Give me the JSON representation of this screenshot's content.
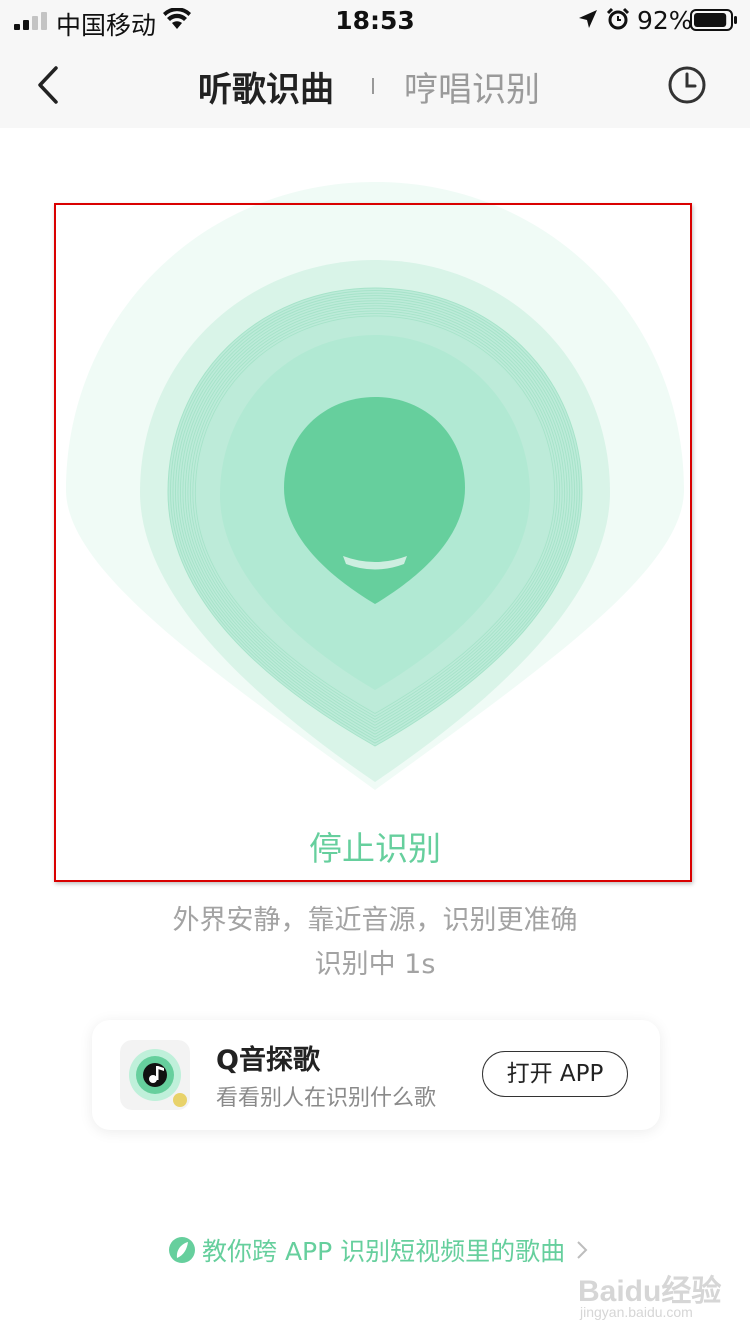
{
  "status_bar": {
    "carrier": "中国移动",
    "time": "18:53",
    "battery_percent": "92%",
    "battery_level": 0.92,
    "icons": [
      "signal-icon",
      "wifi-icon",
      "location-arrow-icon",
      "alarm-icon",
      "battery-icon"
    ]
  },
  "nav": {
    "tabs": [
      {
        "label": "听歌识曲",
        "active": true
      },
      {
        "label": "哼唱识别",
        "active": false
      }
    ],
    "icons": [
      "back-icon",
      "history-icon"
    ]
  },
  "recognition": {
    "stop_label": "停止识别",
    "hint": "外界安静，靠近音源，识别更准确",
    "status": "识别中 1s",
    "accent_color": "#66cf9d"
  },
  "promo": {
    "title": "Q音探歌",
    "subtitle": "看看别人在识别什么歌",
    "button_label": "打开 APP"
  },
  "tutorial": {
    "label": "教你跨 APP 识别短视频里的歌曲"
  },
  "watermark": {
    "main": "Baidu经验",
    "sub": "jingyan.baidu.com"
  }
}
